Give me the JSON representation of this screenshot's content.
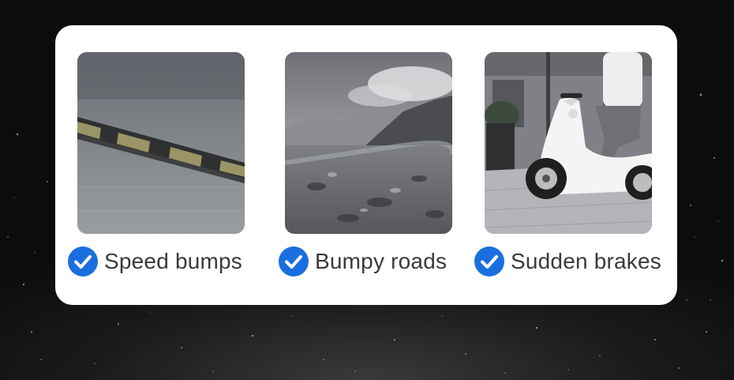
{
  "features": [
    {
      "label": "Speed bumps",
      "image": "speed-bump-photo",
      "icon": "checkmark-icon"
    },
    {
      "label": "Bumpy roads",
      "image": "rocky-road-photo",
      "icon": "checkmark-icon"
    },
    {
      "label": "Sudden brakes",
      "image": "scooter-rider-photo",
      "icon": "checkmark-icon"
    }
  ],
  "colors": {
    "accent": "#1a6fe0",
    "card": "#ffffff",
    "label": "#3a3a3a",
    "background": "#111111"
  }
}
